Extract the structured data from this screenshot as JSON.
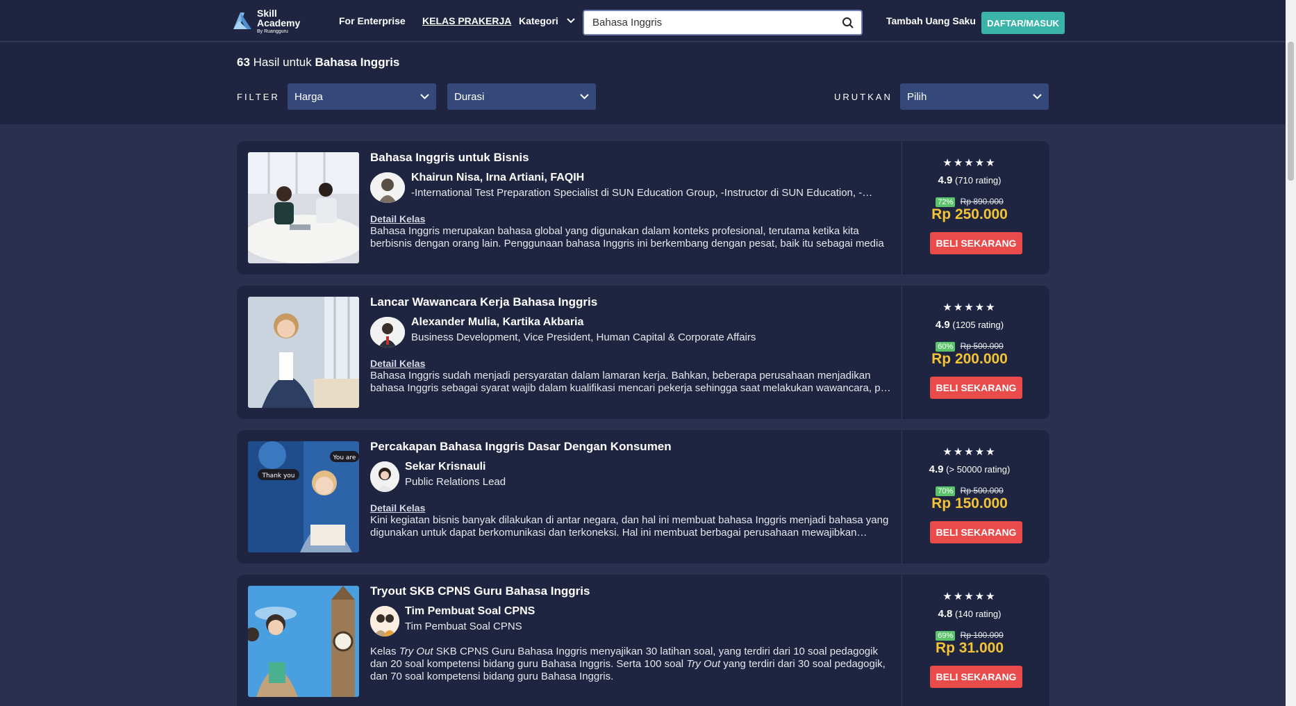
{
  "header": {
    "logo_line1": "Skill",
    "logo_line2": "Academy",
    "logo_line3": "By Ruangguru",
    "nav_enterprise": "For Enterprise",
    "nav_prakerja": "KELAS PRAKERJA",
    "nav_kategori": "Kategori",
    "search_value": "Bahasa Inggris",
    "nav_tambah": "Tambah Uang Saku",
    "btn_daftar": "DAFTAR/MASUK"
  },
  "results": {
    "count": "63",
    "text": "Hasil untuk",
    "query": "Bahasa Inggris"
  },
  "filters": {
    "filter_label": "FILTER",
    "harga": "Harga",
    "durasi": "Durasi",
    "sort_label": "URUTKAN",
    "sort_value": "Pilih"
  },
  "colors": {
    "accent_teal": "#3ab4a8",
    "price_yellow": "#f2c335",
    "buy_red": "#e94b4b",
    "discount_green": "#5bc46a"
  },
  "courses": [
    {
      "title": "Bahasa Inggris untuk Bisnis",
      "instructors": "Khairun Nisa, Irna Artiani, FAQIH",
      "role": "-International Test Preparation Specialist di SUN Education Group, -Instructor di SUN Education, -…",
      "detail": "Detail Kelas",
      "desc": "Bahasa Inggris merupakan bahasa global yang digunakan dalam konteks profesional, terutama ketika kita berbisnis dengan orang lain. Penggunaan bahasa Inggris ini berkembang dengan pesat, baik itu sebagai media",
      "stars": "★★★★★",
      "rating": "4.9",
      "rating_count": "(710 rating)",
      "discount": "72%",
      "old_price": "Rp 890.000",
      "price": "Rp 250.000",
      "buy": "BELI SEKARANG"
    },
    {
      "title": "Lancar Wawancara Kerja Bahasa Inggris",
      "instructors": "Alexander Mulia, Kartika Akbaria",
      "role": "Business Development, Vice President, Human Capital & Corporate Affairs",
      "detail": "Detail Kelas",
      "desc": "Bahasa Inggris sudah menjadi persyaratan dalam lamaran kerja. Bahkan, beberapa perusahaan menjadikan bahasa Inggris sebagai syarat wajib dalam kualifikasi mencari pekerja sehingga saat melakukan wawancara, p…",
      "stars": "★★★★★",
      "rating": "4.9",
      "rating_count": "(1205 rating)",
      "discount": "60%",
      "old_price": "Rp 500.000",
      "price": "Rp 200.000",
      "buy": "BELI SEKARANG"
    },
    {
      "title": "Percakapan Bahasa Inggris Dasar Dengan Konsumen",
      "instructors": "Sekar Krisnauli",
      "role": "Public Relations Lead",
      "detail": "Detail Kelas",
      "desc": "Kini kegiatan bisnis banyak dilakukan di antar negara, dan hal ini membuat bahasa Inggris menjadi bahasa yang digunakan untuk dapat berkomunikasi dan terkoneksi. Hal ini membuat berbagai perusahaan mewajibkan…",
      "img_bubble1": "Thank you",
      "img_bubble2": "You are",
      "stars": "★★★★★",
      "rating": "4.9",
      "rating_count": "(> 50000 rating)",
      "discount": "70%",
      "old_price": "Rp 500.000",
      "price": "Rp 150.000",
      "buy": "BELI SEKARANG"
    },
    {
      "title": "Tryout SKB CPNS Guru Bahasa Inggris",
      "instructors": "Tim Pembuat Soal CPNS",
      "role": "Tim Pembuat Soal CPNS",
      "desc_p1": "Kelas ",
      "desc_i1": "Try Out",
      "desc_p2": " SKB CPNS Guru Bahasa Inggris menyajikan 30 latihan soal, yang terdiri dari 10 soal pedagogik dan 20 soal kompetensi bidang guru Bahasa Inggris. Serta 100 soal ",
      "desc_i2": "Try Out",
      "desc_p3": " yang terdiri dari 30 soal pedagogik, dan 70 soal kompetensi bidang guru Bahasa Inggris.",
      "stars": "★★★★★",
      "rating": "4.8",
      "rating_count": "(140 rating)",
      "discount": "69%",
      "old_price": "Rp 100.000",
      "price": "Rp 31.000",
      "buy": "BELI SEKARANG"
    }
  ]
}
